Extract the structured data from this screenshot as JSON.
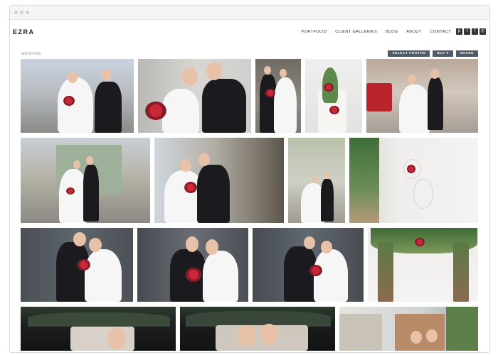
{
  "window": {
    "title": ""
  },
  "site": {
    "logo": "EZRA",
    "nav": [
      "PORTFOLIO",
      "CLIENT GALLERIES",
      "BLOG",
      "ABOUT",
      "CONTACT"
    ],
    "social_icons": [
      "pinterest-icon",
      "twitter-icon",
      "facebook-icon",
      "instagram-icon"
    ]
  },
  "gallery": {
    "breadcrumb": "WEDDING",
    "actions": {
      "select_photos": "SELECT PHOTOS",
      "buy": "BUY ▾",
      "share": "SHARE"
    },
    "photos": [
      "couple-veil-street",
      "bride-kiss-bouquet",
      "couple-walk-street",
      "wedding-cake-flowers",
      "couple-old-town-tram",
      "couple-city-square",
      "couple-embrace-street",
      "couple-building-facade",
      "hanging-glass-decor",
      "couple-dark-wall",
      "couple-smile-bouquet",
      "couple-dark-door",
      "flower-arch-decor",
      "bride-vintage-car",
      "couple-vintage-car",
      "couple-church"
    ]
  },
  "colors": {
    "button_bg": "#4f5c66",
    "text": "#222222"
  }
}
